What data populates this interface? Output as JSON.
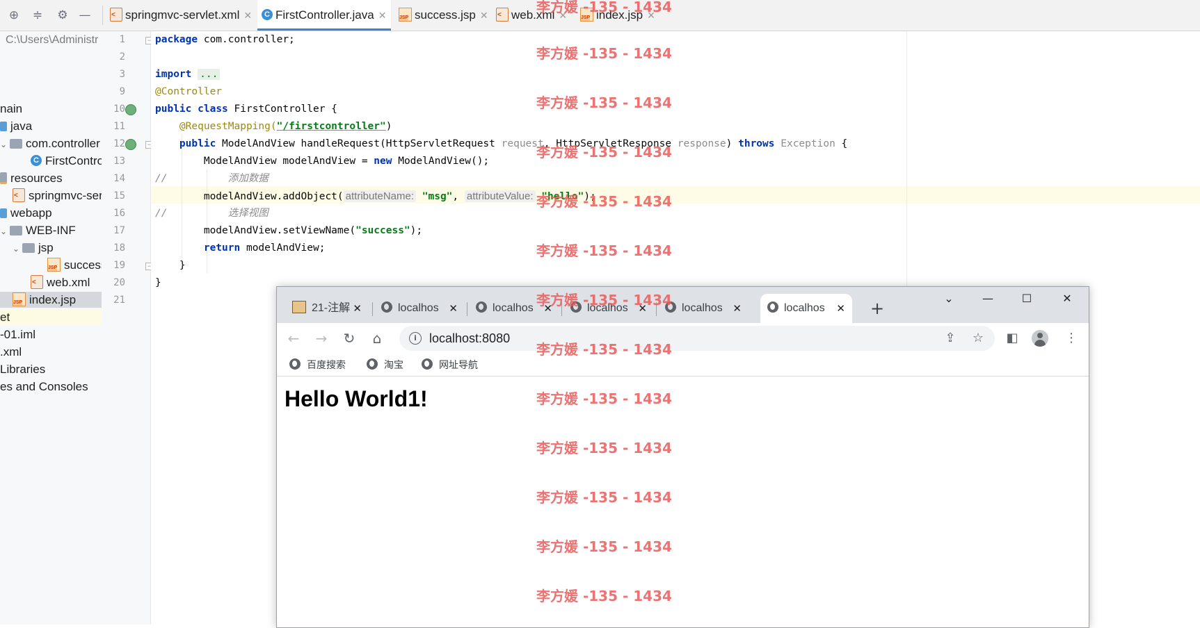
{
  "ide": {
    "editor_tabs": [
      {
        "label": "springmvc-servlet.xml",
        "type": "xml"
      },
      {
        "label": "FirstController.java",
        "type": "class"
      },
      {
        "label": "success.jsp",
        "type": "jsp"
      },
      {
        "label": "web.xml",
        "type": "xml"
      },
      {
        "label": "index.jsp",
        "type": "jsp"
      }
    ],
    "active_tab": "FirstController.java",
    "project_tree": [
      {
        "label": "C:\\Users\\Administr"
      },
      {
        "label": "nain"
      },
      {
        "label": "java"
      },
      {
        "label": "com.controller"
      },
      {
        "label": "FirstContro"
      },
      {
        "label": "resources"
      },
      {
        "label": "springmvc-ser"
      },
      {
        "label": "webapp"
      },
      {
        "label": "WEB-INF"
      },
      {
        "label": "jsp"
      },
      {
        "label": "success"
      },
      {
        "label": "web.xml"
      },
      {
        "label": "index.jsp"
      },
      {
        "label": "et"
      },
      {
        "label": "-01.iml"
      },
      {
        "label": ".xml"
      },
      {
        "label": "Libraries"
      },
      {
        "label": "es and Consoles"
      }
    ],
    "line_numbers": [
      "1",
      "2",
      "3",
      "9",
      "10",
      "11",
      "12",
      "13",
      "14",
      "15",
      "16",
      "17",
      "18",
      "19",
      "20",
      "21"
    ],
    "code": {
      "l1_kw": "package",
      "l1_rest": " com.controller;",
      "l3_kw": "import",
      "l3_fold": "...",
      "l9_ann": "@Controller",
      "l10_kw1": "public",
      "l10_kw2": "class",
      "l10_rest": " FirstController {",
      "l11_ann": "@RequestMapping(",
      "l11_str": "\"/firstcontroller\"",
      "l11_end": ")",
      "l12_kw": "public",
      "l12_a": " ModelAndView handleRequest(HttpServletRequest ",
      "l12_p1": "request",
      "l12_b": ", HttpServletResponse ",
      "l12_p2": "response",
      "l12_c": ") ",
      "l12_kw2": "throws",
      "l12_exc": " Exception",
      "l12_d": " {",
      "l13_a": "ModelAndView modelAndView = ",
      "l13_kw": "new",
      "l13_b": " ModelAndView();",
      "l14_slash": "//",
      "l14_cm": "添加数据",
      "l15_a": "modelAndView.addObject(",
      "l15_hint1": "attributeName:",
      "l15_str1": "\"msg\"",
      "l15_comma": ", ",
      "l15_hint2": "attributeValue:",
      "l15_str2": "\"hello\"",
      "l15_end": ");",
      "l16_slash": "//",
      "l16_cm": "选择视图",
      "l17_a": "modelAndView.setViewName(",
      "l17_str": "\"success\"",
      "l17_end": ");",
      "l18_kw": "return",
      "l18_rest": " modelAndView;",
      "l19": "}",
      "l20": "}"
    }
  },
  "browser": {
    "tabs": [
      {
        "label": "21-注解",
        "icon": "image-favicon"
      },
      {
        "label": "localhost",
        "icon": "globe-icon"
      },
      {
        "label": "localhost",
        "icon": "globe-icon"
      },
      {
        "label": "localhost",
        "icon": "globe-icon"
      },
      {
        "label": "localhost",
        "icon": "globe-icon"
      },
      {
        "label": "localhost",
        "icon": "globe-icon",
        "active": true
      }
    ],
    "url": "localhost:8080",
    "bookmarks": [
      "百度搜索",
      "淘宝",
      "网址导航"
    ],
    "page_heading": "Hello World1!"
  },
  "watermark": {
    "text": "李方媛 -135 - 1434"
  },
  "colors": {
    "keyword": "#0033b3",
    "annotation": "#9e880d",
    "string": "#067d17",
    "comment": "#8c8c8c",
    "watermark": "#e85a5a",
    "active_tab_underline": "#4083c9"
  }
}
